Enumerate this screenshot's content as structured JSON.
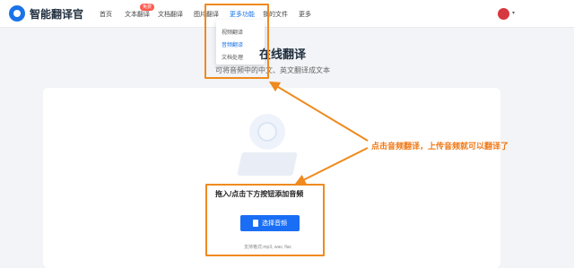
{
  "header": {
    "logo_text": "智能翻译官",
    "nav": [
      {
        "label": "首页"
      },
      {
        "label": "文本翻译",
        "badge": "免费"
      },
      {
        "label": "文档翻译"
      },
      {
        "label": "图片翻译"
      },
      {
        "label": "更多功能"
      },
      {
        "label": "我的文件"
      },
      {
        "label": "更多"
      }
    ]
  },
  "dropdown": {
    "items": [
      "视频翻译",
      "音频翻译",
      "文档处理"
    ],
    "selected": "音频翻译"
  },
  "main": {
    "title": "在线翻译",
    "subtitle": "可将音频中的中文、英文翻译成文本",
    "upload_hint": "拖入/点击下方按钮添加音频",
    "choose_button": "选择音频",
    "formats": "支持格式:mp3, wav, flac"
  },
  "annotation": {
    "text": "点击音频翻译，上传音频就可以翻译了",
    "color": "#ef8a1f"
  },
  "colors": {
    "accent": "#1a6ef5",
    "page_bg": "#f2f4f7"
  }
}
